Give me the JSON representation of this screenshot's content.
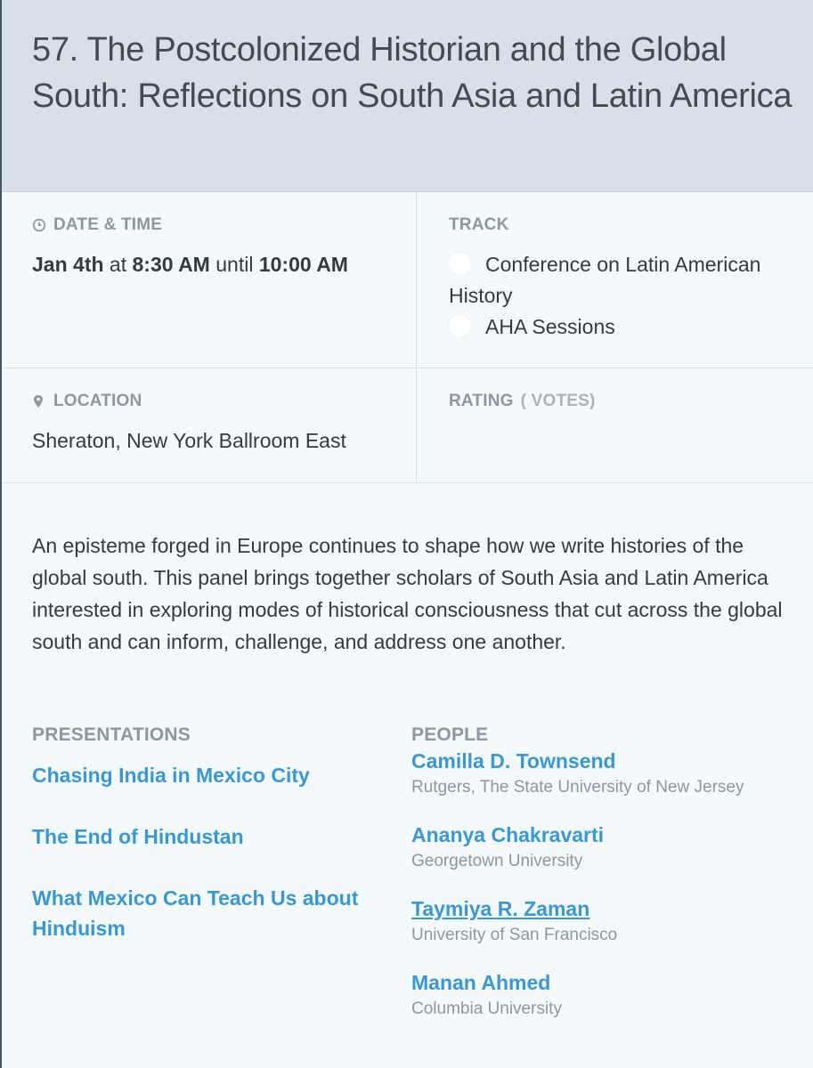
{
  "session": {
    "title": "57. The Postcolonized Historian and the Global South: Reflections on South Asia and Latin America"
  },
  "datetime": {
    "label": "DATE & TIME",
    "date": "Jan 4th",
    "at": "at",
    "start": "8:30 AM",
    "until": "until",
    "end": "10:00 AM"
  },
  "track": {
    "label": "TRACK",
    "items": [
      "Conference on Latin American History",
      "AHA Sessions"
    ]
  },
  "location": {
    "label": "LOCATION",
    "value": "Sheraton, New York Ballroom East"
  },
  "rating": {
    "label": "RATING",
    "votes": "( VOTES)"
  },
  "description": "An episteme forged in Europe continues to shape how we write histories of the global south. This panel brings together scholars of South Asia and Latin America interested in exploring modes of historical consciousness that cut across the global south and can inform, challenge, and address one another.",
  "presentations": {
    "heading": "PRESENTATIONS",
    "items": [
      "Chasing India in Mexico City",
      "The End of Hindustan",
      "What Mexico Can Teach Us about Hinduism"
    ]
  },
  "people": {
    "heading": "PEOPLE",
    "items": [
      {
        "name": "Camilla D. Townsend",
        "affiliation": "Rutgers, The State University of New Jersey"
      },
      {
        "name": "Ananya Chakravarti",
        "affiliation": "Georgetown University"
      },
      {
        "name": "Taymiya R. Zaman",
        "affiliation": "University of San Francisco"
      },
      {
        "name": "Manan Ahmed",
        "affiliation": "Columbia University"
      }
    ]
  },
  "colors": {
    "link": "#3b97d3",
    "header_bg": "#d7e0e6",
    "page_bg": "#f4f9fc",
    "label": "#8d979e"
  },
  "icons": {
    "datetime": "clock-icon",
    "location": "map-pin-icon"
  }
}
